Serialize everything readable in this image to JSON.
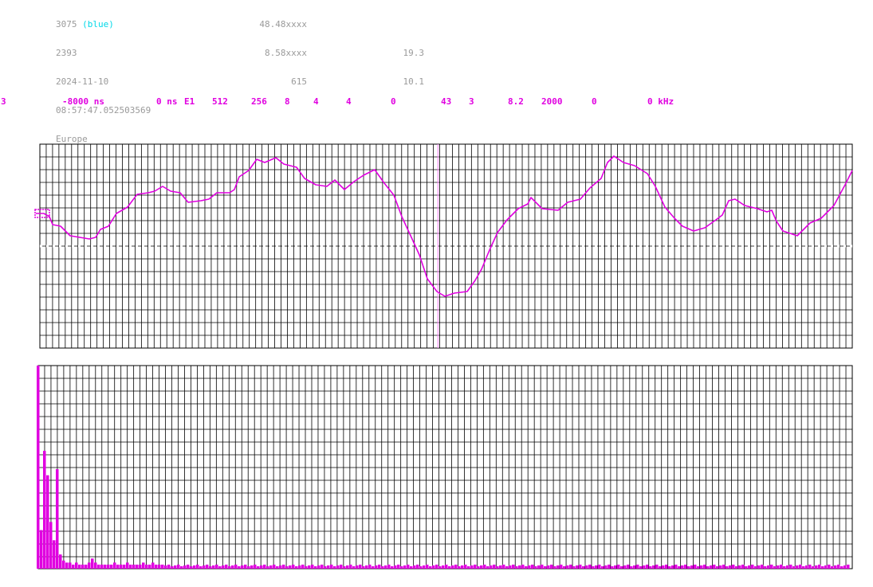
{
  "header": {
    "left": [
      "3075",
      "2393",
      "2024-11-10",
      "08:57:47.052503569",
      "Europe"
    ],
    "left_tag": "(blue)",
    "mid": [
      "48.48xxxx",
      "8.58xxxx",
      "615"
    ],
    "right": [
      "19.3",
      "10.1"
    ]
  },
  "params": [
    "3",
    "-8000 ns",
    "0 ns",
    "E1",
    "512",
    "256",
    "8",
    "4",
    "4",
    "0",
    "43",
    "3",
    "8.2",
    "2000",
    "0",
    "0 kHz"
  ],
  "colors": {
    "trace": "#e000e0",
    "grid": "#000000",
    "info": "#9a9a9a",
    "tag": "#00d8e8",
    "cursor": "#ff80ff"
  },
  "waveform_plot": {
    "type": "line",
    "grid": true,
    "cursor_x_fraction": 0.49
  },
  "spectrum_plot": {
    "type": "bar",
    "grid": true,
    "bar_levels": [
      1.0,
      0.19,
      0.58,
      0.46,
      0.23,
      0.14,
      0.49,
      0.07,
      0.04,
      0.03,
      0.03,
      0.02,
      0.03,
      0.02,
      0.02,
      0.02,
      0.03,
      0.05,
      0.03,
      0.02,
      0.02,
      0.02,
      0.02,
      0.02,
      0.03,
      0.02,
      0.02,
      0.02,
      0.03,
      0.02,
      0.02,
      0.02,
      0.02,
      0.03,
      0.02,
      0.02,
      0.03,
      0.02,
      0.02,
      0.02
    ]
  }
}
